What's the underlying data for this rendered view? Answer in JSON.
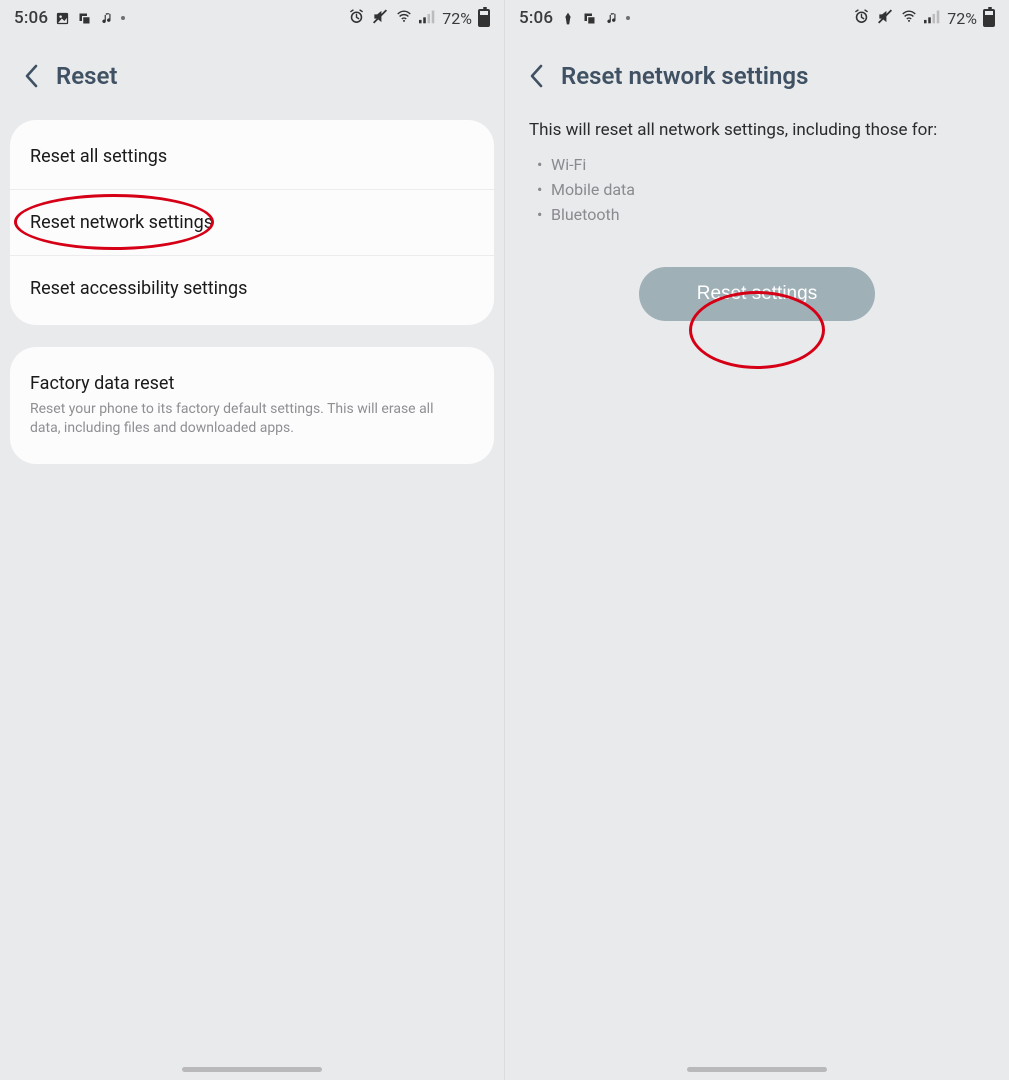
{
  "status": {
    "time": "5:06",
    "battery_pct": "72%"
  },
  "left": {
    "title": "Reset",
    "rows": {
      "all": "Reset all settings",
      "network": "Reset network settings",
      "accessibility": "Reset accessibility settings"
    },
    "factory": {
      "title": "Factory data reset",
      "sub": "Reset your phone to its factory default settings. This will erase all data, including files and downloaded apps."
    }
  },
  "right": {
    "title": "Reset network settings",
    "desc": "This will reset all network settings, including those for:",
    "bullets": {
      "b0": "Wi-Fi",
      "b1": "Mobile data",
      "b2": "Bluetooth"
    },
    "button": "Reset settings"
  }
}
